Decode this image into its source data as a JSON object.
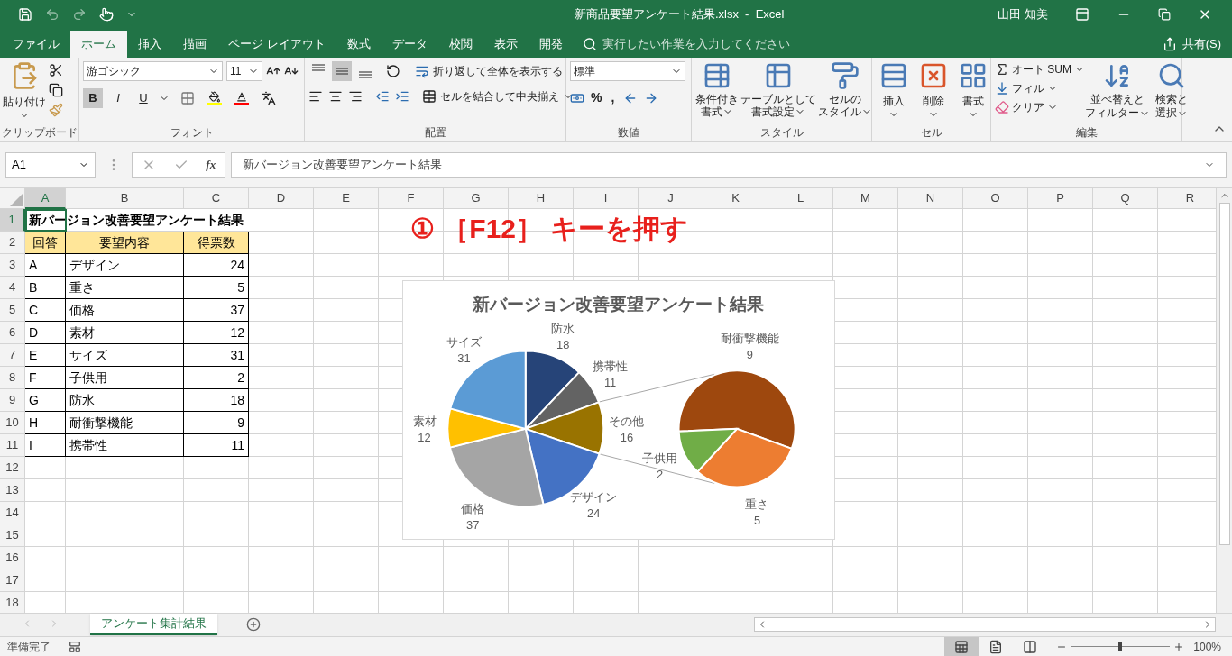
{
  "window": {
    "title": "新商品要望アンケート結果.xlsx  -  Excel",
    "user": "山田 知美"
  },
  "ribbon_tabs": [
    {
      "label": "ファイル",
      "selected": false
    },
    {
      "label": "ホーム",
      "selected": true
    },
    {
      "label": "挿入",
      "selected": false
    },
    {
      "label": "描画",
      "selected": false
    },
    {
      "label": "ページ レイアウト",
      "selected": false
    },
    {
      "label": "数式",
      "selected": false
    },
    {
      "label": "データ",
      "selected": false
    },
    {
      "label": "校閲",
      "selected": false
    },
    {
      "label": "表示",
      "selected": false
    },
    {
      "label": "開発",
      "selected": false
    }
  ],
  "tell_me": {
    "placeholder": "実行したい作業を入力してください"
  },
  "share": "共有(S)",
  "clipboard": {
    "label": "クリップボード",
    "paste": "貼り付け"
  },
  "font": {
    "label": "フォント",
    "name": "游ゴシック",
    "size": "11",
    "styles": [
      {
        "text": "B",
        "kind": "bold",
        "selected": true
      },
      {
        "text": "I",
        "kind": "italic",
        "selected": false
      },
      {
        "text": "U",
        "kind": "underline",
        "selected": false
      }
    ]
  },
  "alignment": {
    "label": "配置",
    "vertical": [
      {
        "kind": "top",
        "selected": false
      },
      {
        "kind": "middle",
        "selected": true
      },
      {
        "kind": "bottom",
        "selected": false
      }
    ],
    "wrap": "折り返して全体を表示する",
    "merge": "セルを結合して中央揃え"
  },
  "number": {
    "label": "数値",
    "format": "標準",
    "percent": "%",
    "comma": ","
  },
  "styles": {
    "label": "スタイル",
    "buttons": [
      {
        "kind": "conditional",
        "lines": [
          "条件付き",
          "書式"
        ]
      },
      {
        "kind": "table",
        "lines": [
          "テーブルとして",
          "書式設定"
        ]
      },
      {
        "kind": "cell",
        "lines": [
          "セルの",
          "スタイル"
        ]
      }
    ]
  },
  "cells": {
    "label": "セル",
    "buttons": [
      {
        "kind": "insert",
        "text": "挿入"
      },
      {
        "kind": "delete",
        "text": "削除"
      },
      {
        "kind": "format",
        "text": "書式"
      }
    ]
  },
  "editing": {
    "label": "編集",
    "small": [
      {
        "kind": "sum",
        "text": "オート SUM"
      },
      {
        "kind": "fill",
        "text": "フィル"
      },
      {
        "kind": "clear",
        "text": "クリア"
      }
    ],
    "large": [
      {
        "kind": "sort",
        "lines": [
          "並べ替えと",
          "フィルター"
        ]
      },
      {
        "kind": "find",
        "lines": [
          "検索と",
          "選択"
        ]
      }
    ]
  },
  "formula_bar": {
    "name_box": "A1",
    "fx": "fx",
    "value": "新バージョン改善要望アンケート結果"
  },
  "columns": [
    {
      "label": "A",
      "selected": true
    },
    {
      "label": "B",
      "selected": false
    },
    {
      "label": "C",
      "selected": false
    },
    {
      "label": "D",
      "selected": false
    },
    {
      "label": "E",
      "selected": false
    },
    {
      "label": "F",
      "selected": false
    },
    {
      "label": "G",
      "selected": false
    },
    {
      "label": "H",
      "selected": false
    },
    {
      "label": "I",
      "selected": false
    },
    {
      "label": "J",
      "selected": false
    },
    {
      "label": "K",
      "selected": false
    },
    {
      "label": "L",
      "selected": false
    },
    {
      "label": "M",
      "selected": false
    },
    {
      "label": "N",
      "selected": false
    },
    {
      "label": "O",
      "selected": false
    },
    {
      "label": "P",
      "selected": false
    },
    {
      "label": "Q",
      "selected": false
    },
    {
      "label": "R",
      "selected": false
    }
  ],
  "rows": [
    {
      "number": "1",
      "selected": true,
      "kind": "title",
      "title": "新バージョン改善要望アンケート結果"
    },
    {
      "number": "2",
      "selected": false,
      "kind": "header",
      "cells": [
        "回答",
        "要望内容",
        "得票数"
      ]
    },
    {
      "number": "3",
      "selected": false,
      "kind": "data",
      "cells": [
        "A",
        "デザイン",
        "24"
      ]
    },
    {
      "number": "4",
      "selected": false,
      "kind": "data",
      "cells": [
        "B",
        "重さ",
        "5"
      ]
    },
    {
      "number": "5",
      "selected": false,
      "kind": "data",
      "cells": [
        "C",
        "価格",
        "37"
      ]
    },
    {
      "number": "6",
      "selected": false,
      "kind": "data",
      "cells": [
        "D",
        "素材",
        "12"
      ]
    },
    {
      "number": "7",
      "selected": false,
      "kind": "data",
      "cells": [
        "E",
        "サイズ",
        "31"
      ]
    },
    {
      "number": "8",
      "selected": false,
      "kind": "data",
      "cells": [
        "F",
        "子供用",
        "2"
      ]
    },
    {
      "number": "9",
      "selected": false,
      "kind": "data",
      "cells": [
        "G",
        "防水",
        "18"
      ]
    },
    {
      "number": "10",
      "selected": false,
      "kind": "data",
      "cells": [
        "H",
        "耐衝撃機能",
        "9"
      ]
    },
    {
      "number": "11",
      "selected": false,
      "kind": "data",
      "cells": [
        "I",
        "携帯性",
        "11"
      ]
    },
    {
      "number": "12",
      "selected": false,
      "kind": "empty"
    },
    {
      "number": "13",
      "selected": false,
      "kind": "empty"
    },
    {
      "number": "14",
      "selected": false,
      "kind": "empty"
    },
    {
      "number": "15",
      "selected": false,
      "kind": "empty"
    },
    {
      "number": "16",
      "selected": false,
      "kind": "empty"
    },
    {
      "number": "17",
      "selected": false,
      "kind": "empty"
    },
    {
      "number": "18",
      "selected": false,
      "kind": "empty"
    }
  ],
  "annotation": "① ［F12］ キーを押す",
  "chart": {
    "chart_data": {
      "type": "pie",
      "title": "新バージョン改善要望アンケート結果",
      "categories": [
        "防水",
        "携帯性",
        "その他",
        "デザイン",
        "価格",
        "素材",
        "サイズ"
      ],
      "values": [
        18,
        11,
        16,
        24,
        37,
        12,
        31
      ],
      "data_labels": true
    },
    "secondary": {
      "chart_data": {
        "type": "pie",
        "categories": [
          "耐衝撃機能",
          "重さ",
          "子供用"
        ],
        "values": [
          9,
          5,
          2
        ],
        "data_labels": true
      }
    }
  },
  "sheet_tabs": [
    {
      "label": "アンケート集計結果",
      "selected": true
    }
  ],
  "status_bar": {
    "text": "準備完了",
    "views": [
      {
        "kind": "normal",
        "selected": true
      },
      {
        "kind": "page_layout",
        "selected": false
      },
      {
        "kind": "page_break",
        "selected": false
      }
    ],
    "zoom": {
      "level": 0.5,
      "reading": "100%"
    }
  }
}
